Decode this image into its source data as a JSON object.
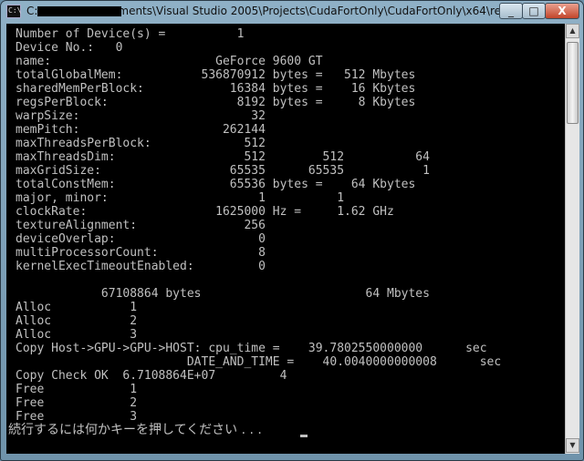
{
  "window": {
    "title": "C:\\Users\\...\\Documents\\Visual Studio 2005\\Projects\\CudaFortOnly\\CudaFortOnly\\x64\\release\\cu...",
    "icon_label": "C:\\",
    "buttons": {
      "minimize": "_",
      "maximize": "□",
      "close": "X"
    }
  },
  "console": {
    "lines": [
      "Number of Device(s) =          1",
      "Device No.:   0",
      "name:                       GeForce 9600 GT",
      "totalGlobalMem:           536870912 bytes =   512 Mbytes",
      "sharedMemPerBlock:            16384 bytes =    16 Kbytes",
      "regsPerBlock:                  8192 bytes =     8 Kbytes",
      "warpSize:                        32",
      "memPitch:                    262144",
      "maxThreadsPerBlock:             512",
      "maxThreadsDim:                  512        512          64",
      "maxGridSize:                  65535      65535           1",
      "totalConstMem:                65536 bytes =    64 Kbytes",
      "major, minor:                     1          1",
      "clockRate:                  1625000 Hz =     1.62 GHz",
      "textureAlignment:               256",
      "deviceOverlap:                    0",
      "multiProcessorCount:              8",
      "kernelExecTimeoutEnabled:         0",
      "",
      "            67108864 bytes                       64 Mbytes",
      "Alloc           1",
      "Alloc           2",
      "Alloc           3",
      "Copy Host->GPU->GPU->HOST: cpu_time =    39.7802550000000      sec",
      "                        DATE_AND_TIME =    40.0040000000008      sec",
      "Copy Check OK  6.7108864E+07         4",
      "Free            1",
      "Free            2",
      "Free            3"
    ],
    "prompt": "続行するには何かキーを押してください . . ."
  }
}
